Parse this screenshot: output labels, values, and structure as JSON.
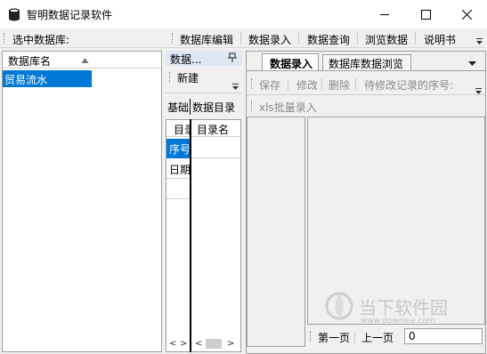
{
  "window": {
    "title": "智明数据记录软件",
    "minimize_icon": "minimize-icon",
    "maximize_icon": "maximize-icon",
    "close_icon": "close-icon"
  },
  "toolbar": {
    "db_label": "选中数据库:",
    "menu": [
      "数据库编辑",
      "数据录入",
      "数据查询",
      "浏览数据",
      "说明书"
    ]
  },
  "left_panel": {
    "column_header": "数据库名",
    "rows": [
      "贸易流水"
    ]
  },
  "middle_panel": {
    "dock_title": "数据...",
    "new_button": "新建",
    "tabs": [
      "基础",
      "数据目录"
    ],
    "grid1": {
      "header": "目录",
      "rows": [
        "序号",
        "日期"
      ]
    },
    "grid2": {
      "header": "目录名"
    }
  },
  "right_panel": {
    "tabs": [
      "数据录入",
      "数据库数据浏览"
    ],
    "actions": {
      "save": "保存",
      "edit": "修改",
      "delete": "删除",
      "record_label": "待修改记录的序号:"
    },
    "xls_import": "xls批量录入",
    "pager": {
      "first": "第一页",
      "prev": "上一页",
      "page_value": "0"
    }
  },
  "watermark": {
    "text": "当下软件园",
    "url": "www.downxia.com"
  },
  "colors": {
    "selection": "#0078d7",
    "dock_title": "#dfe7f3"
  }
}
